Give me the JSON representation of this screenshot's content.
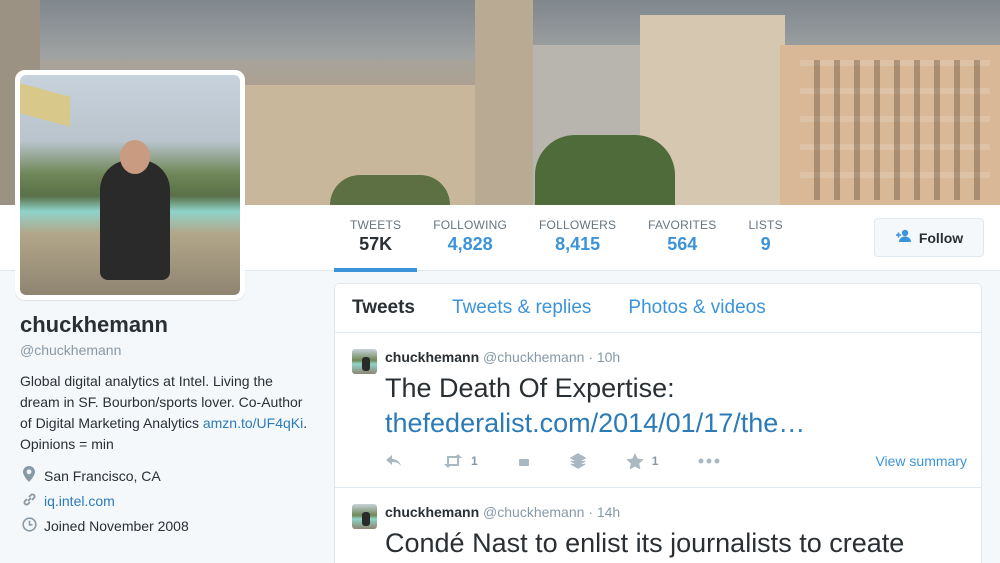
{
  "profile": {
    "fullname": "chuckhemann",
    "handle": "@chuckhemann",
    "bio_text": "Global digital analytics at Intel. Living the dream in SF. Bourbon/sports lover. Co-Author of Digital Marketing Analytics ",
    "bio_link": "amzn.to/UF4qKi",
    "bio_suffix": ". Opinions = min",
    "location": "San Francisco, CA",
    "url": "iq.intel.com",
    "joined": "Joined November 2008"
  },
  "nav": {
    "stats": [
      {
        "label": "TWEETS",
        "value": "57K"
      },
      {
        "label": "FOLLOWING",
        "value": "4,828"
      },
      {
        "label": "FOLLOWERS",
        "value": "8,415"
      },
      {
        "label": "FAVORITES",
        "value": "564"
      },
      {
        "label": "LISTS",
        "value": "9"
      }
    ],
    "follow_label": "Follow"
  },
  "timeline": {
    "tabs": [
      "Tweets",
      "Tweets & replies",
      "Photos & videos"
    ],
    "tweets": [
      {
        "name": "chuckhemann",
        "screen_name": "@chuckhemann",
        "time": "· 10h",
        "line1": "The Death Of Expertise:",
        "line2": "thefederalist.com/2014/01/17/the…",
        "retweets": "1",
        "favorites": "1",
        "view_summary": "View summary"
      },
      {
        "name": "chuckhemann",
        "screen_name": "@chuckhemann",
        "time": "· 14h",
        "line1": "Condé Nast to enlist its journalists to create"
      }
    ]
  },
  "colors": {
    "link": "#2b7bb9",
    "accent": "#3b94d9",
    "text": "#292f33",
    "muted": "#8899a6"
  },
  "icons": {
    "location": "map-pin-icon",
    "url": "link-icon",
    "joined": "calendar-icon",
    "follow": "add-user-icon"
  }
}
